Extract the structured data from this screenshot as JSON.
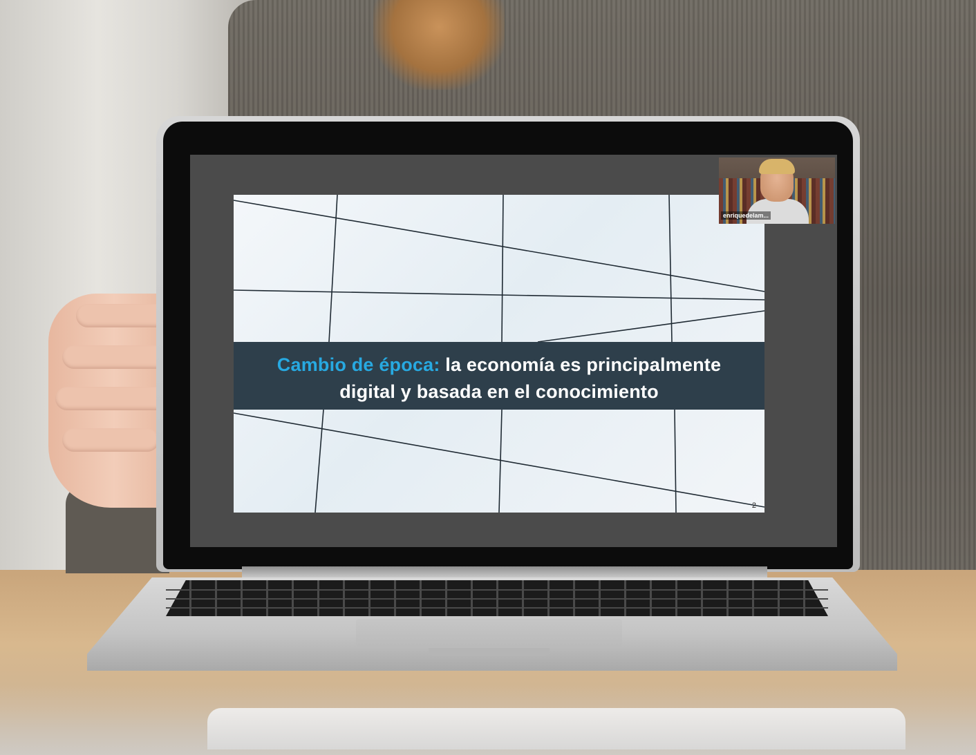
{
  "slide": {
    "title_highlight": "Cambio de época:",
    "title_line1_rest": " la economía es principalmente",
    "title_line2": "digital y basada en el conocimiento",
    "page_number": "2"
  },
  "webcam": {
    "participant_name": "enriquedelam..."
  },
  "colors": {
    "title_accent": "#27a9e1",
    "title_band": "#2e3f4b",
    "screen_background": "#4b4b4b"
  },
  "icons": []
}
